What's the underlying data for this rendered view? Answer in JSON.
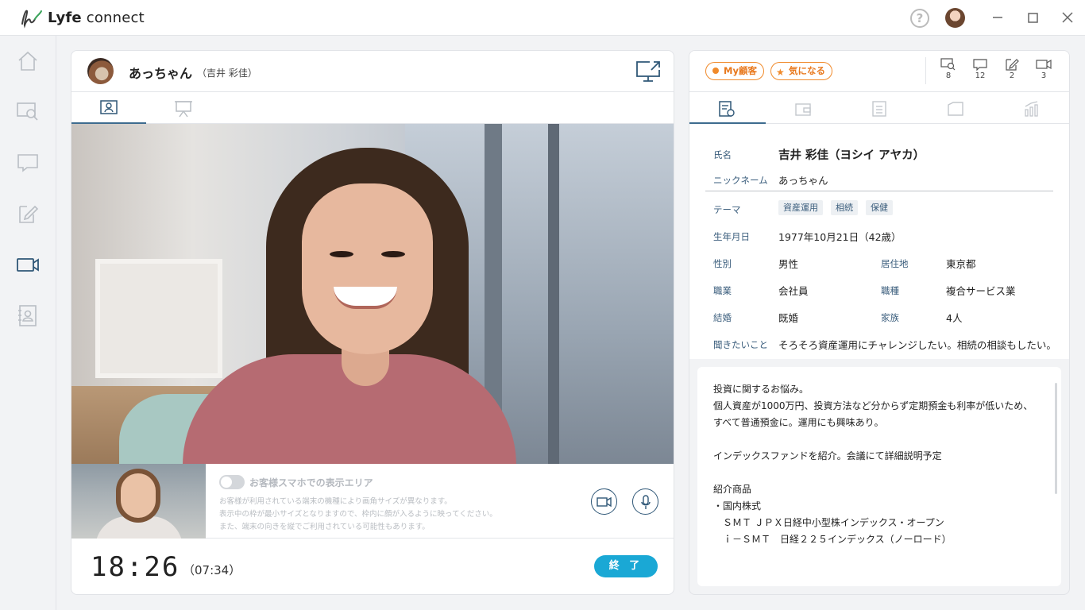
{
  "app": {
    "title_bold": "Lyfe",
    "title_rest": " connect"
  },
  "window_controls": [
    "minimize",
    "maximize",
    "close"
  ],
  "titlebar": {
    "help_label": "?"
  },
  "sidebar": {
    "items": [
      {
        "name": "home",
        "icon": "home-icon"
      },
      {
        "name": "customer-search",
        "icon": "search-card-icon"
      },
      {
        "name": "chat",
        "icon": "chat-icon"
      },
      {
        "name": "notes",
        "icon": "edit-note-icon"
      },
      {
        "name": "video-call",
        "icon": "video-icon",
        "active": true
      },
      {
        "name": "contacts",
        "icon": "contact-book-icon"
      }
    ]
  },
  "call": {
    "customer_nickname": "あっちゃん",
    "customer_realname": "（吉井 彩佳）",
    "tabs": [
      "profile",
      "presentation"
    ],
    "display_area_label": "お客様スマホでの表示エリア",
    "notice_lines": [
      "お客様が利用されている端末の機種により画角サイズが異なります。",
      "表示中の枠が最小サイズとなりますので、枠内に顔が入るように映ってください。",
      "また、端末の向きを縦でご利用されている可能性もあります。"
    ],
    "clock": "18:26",
    "elapsed": "（07:34）",
    "end_label": "終 了"
  },
  "right": {
    "badges": {
      "my_customer": "My顧客",
      "interested": "気になる"
    },
    "stats": [
      {
        "icon": "search-card-icon",
        "count": "8"
      },
      {
        "icon": "chat-icon",
        "count": "12"
      },
      {
        "icon": "edit-note-icon",
        "count": "2"
      },
      {
        "icon": "video-icon",
        "count": "3"
      }
    ],
    "profile": {
      "name_label": "氏名",
      "name_value": "吉井 彩佳（ヨシイ アヤカ）",
      "nickname_label": "ニックネーム",
      "nickname_value": "あっちゃん",
      "theme_label": "テーマ",
      "themes": [
        "資産運用",
        "相続",
        "保健"
      ],
      "birth_label": "生年月日",
      "birth_value": "1977年10月21日（42歳）",
      "gender_label": "性別",
      "gender_value": "男性",
      "residence_label": "居住地",
      "residence_value": "東京都",
      "job_label": "職業",
      "job_value": "会社員",
      "jobtype_label": "職種",
      "jobtype_value": "複合サービス業",
      "marriage_label": "結婚",
      "marriage_value": "既婚",
      "family_label": "家族",
      "family_value": "4人",
      "question_label": "聞きたいこと",
      "question_value": "そろそろ資産運用にチャレンジしたい。相続の相談もしたい。"
    },
    "memo_lines": [
      "投資に関するお悩み。",
      "個人資産が1000万円、投資方法など分からず定期預金も利率が低いため、",
      "すべて普通預金に。運用にも興味あり。",
      "",
      "インデックスファンドを紹介。会議にて詳細説明予定",
      "",
      "紹介商品",
      "・国内株式",
      "　ＳＭＴ ＪＰＸ日経中小型株インデックス・オープン",
      "　ｉ－ＳＭＴ　日経２２５インデックス（ノーロード）"
    ]
  }
}
